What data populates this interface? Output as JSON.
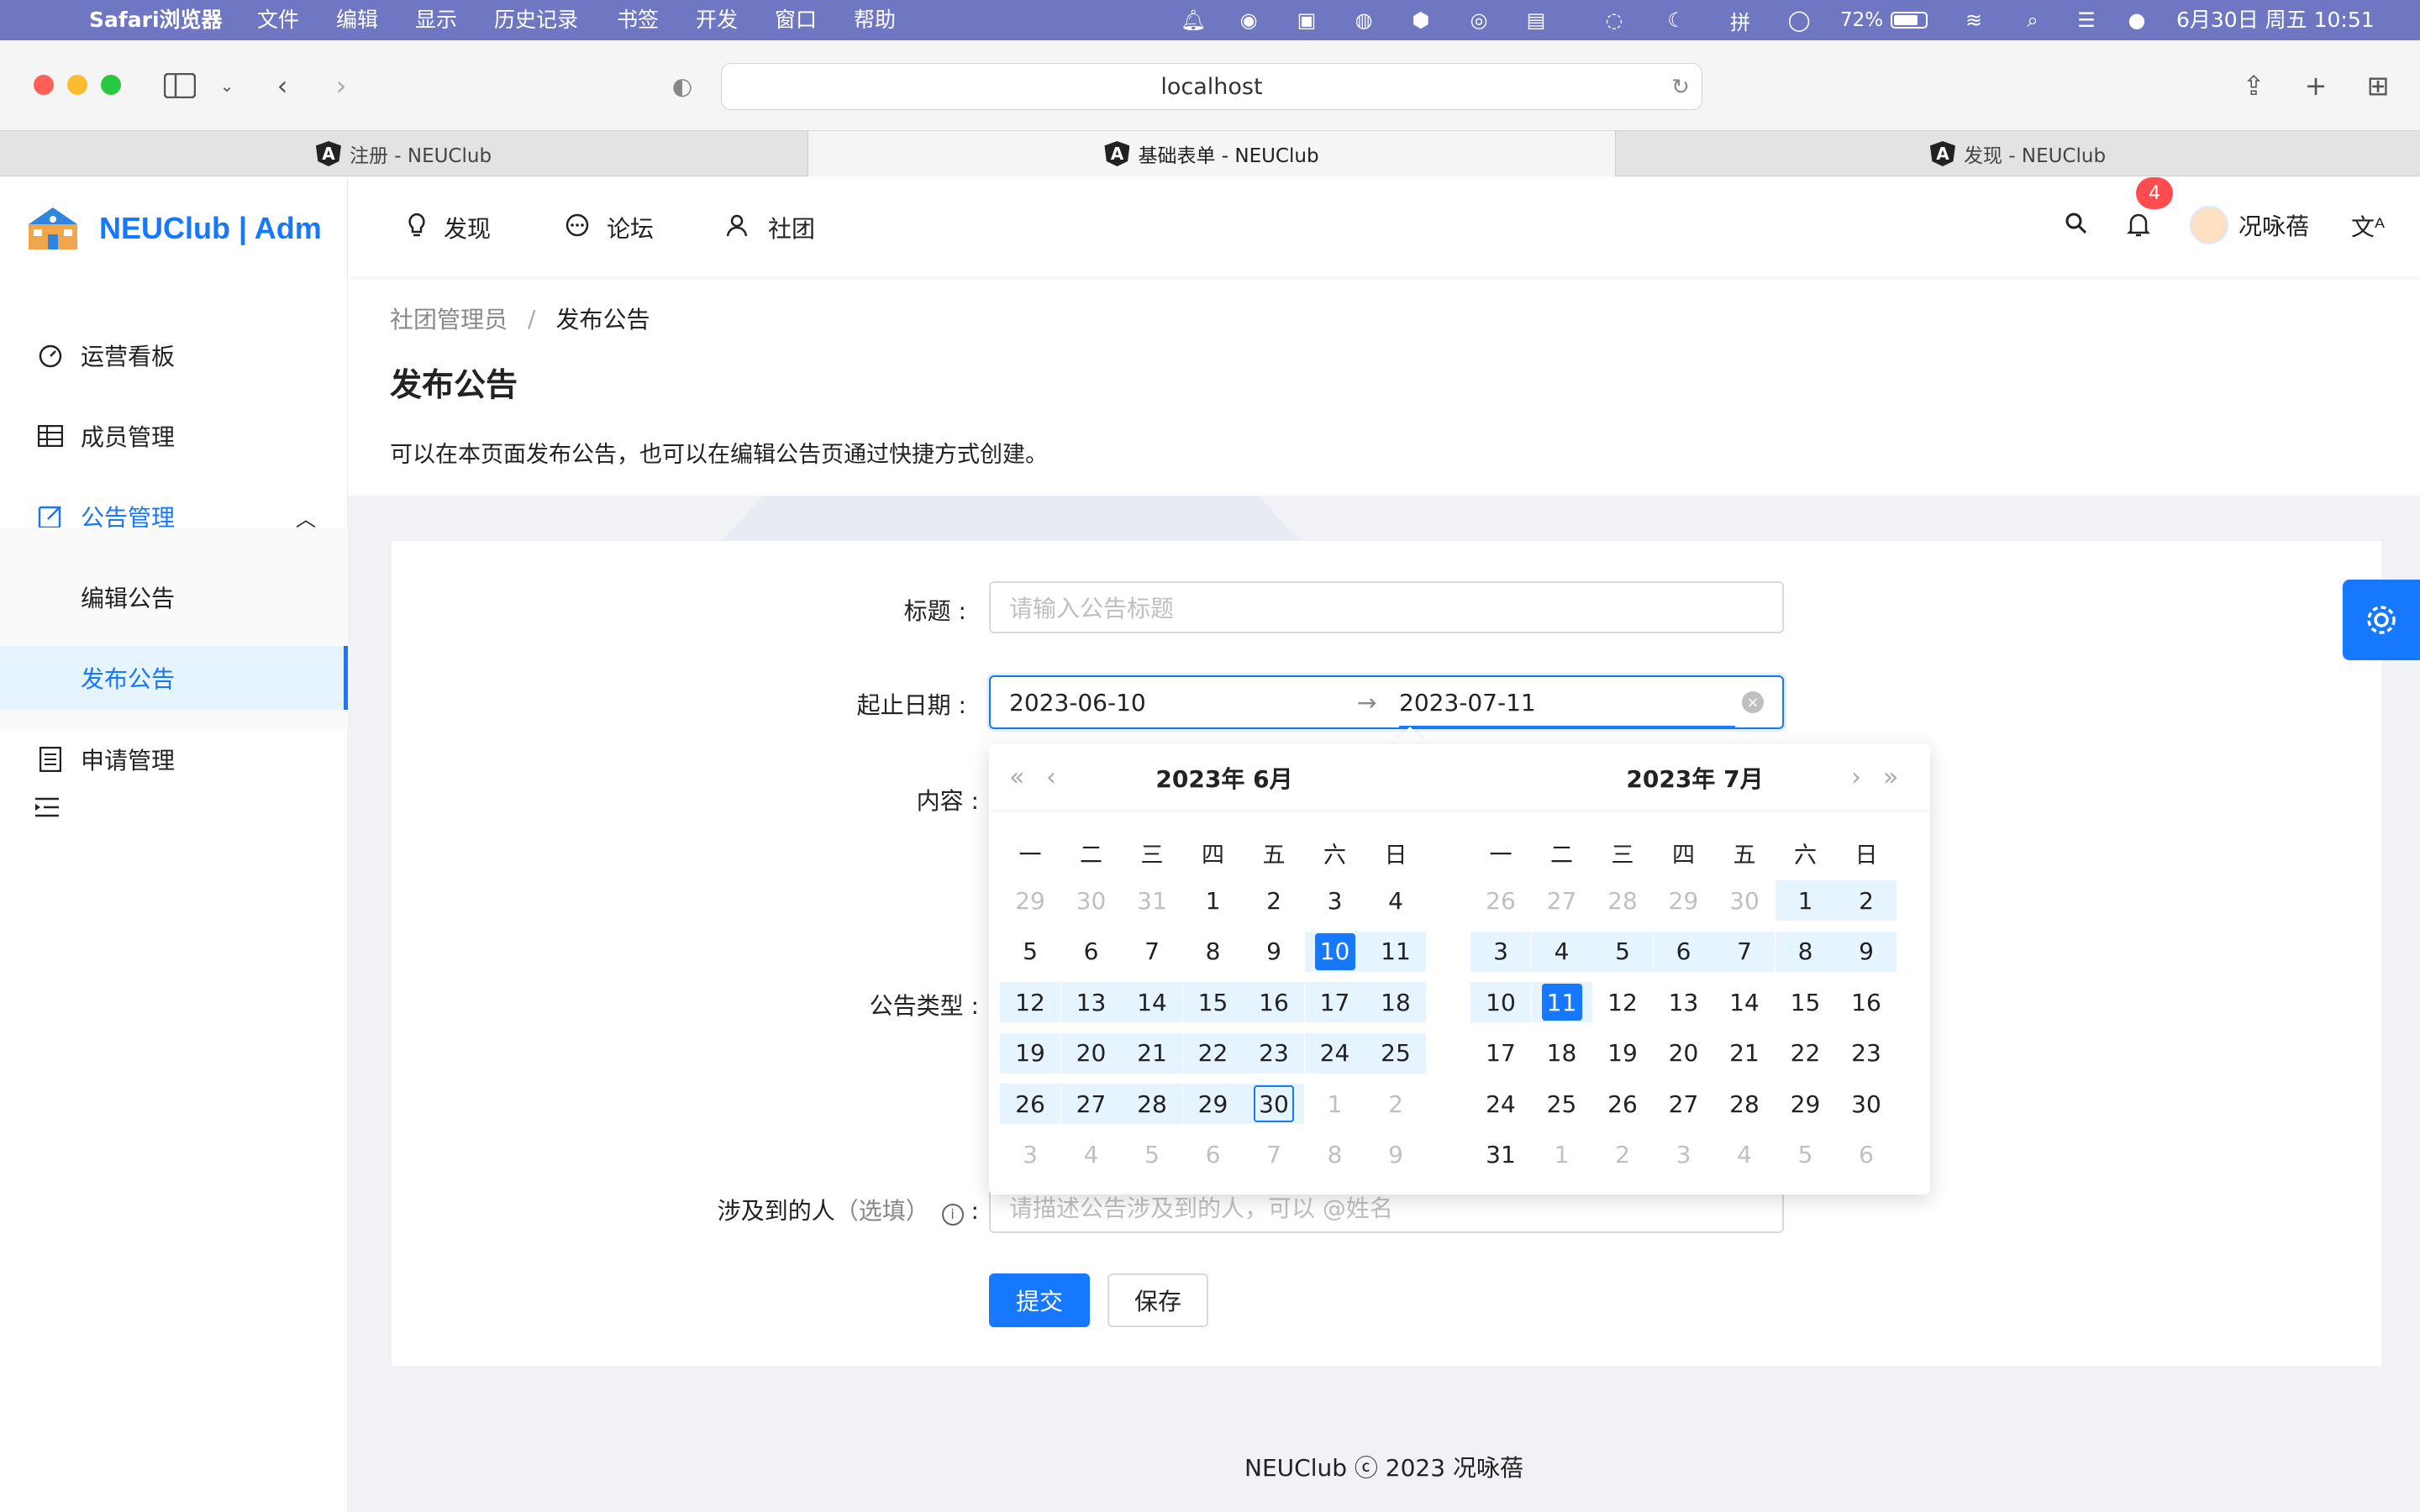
{
  "menubar": {
    "app": "Safari浏览器",
    "items": [
      "文件",
      "编辑",
      "显示",
      "历史记录",
      "书签",
      "开发",
      "窗口",
      "帮助"
    ],
    "battery": "72%",
    "datetime": "6月30日 周五  10:51"
  },
  "browser": {
    "url": "localhost",
    "tabs": [
      {
        "title": "注册 - NEUClub"
      },
      {
        "title": "基础表单 - NEUClub"
      },
      {
        "title": "发现 - NEUClub"
      }
    ]
  },
  "sidebar": {
    "logo": "NEUClub | Adm",
    "items": [
      {
        "label": "运营看板",
        "icon": "dashboard-icon"
      },
      {
        "label": "成员管理",
        "icon": "table-icon"
      },
      {
        "label": "公告管理",
        "icon": "edit-icon"
      },
      {
        "label": "编辑公告"
      },
      {
        "label": "发布公告"
      },
      {
        "label": "申请管理",
        "icon": "profile-icon"
      }
    ]
  },
  "header": {
    "nav": [
      {
        "label": "发现",
        "icon": "bulb-icon"
      },
      {
        "label": "论坛",
        "icon": "message-icon"
      },
      {
        "label": "社团",
        "icon": "team-icon"
      }
    ],
    "notification_count": "4",
    "user": "况咏蓓"
  },
  "page": {
    "breadcrumb": [
      "社团管理员",
      "发布公告"
    ],
    "title": "发布公告",
    "desc": "可以在本页面发布公告，也可以在编辑公告页通过快捷方式创建。"
  },
  "form": {
    "title_label": "标题",
    "title_placeholder": "请输入公告标题",
    "date_label": "起止日期",
    "start_date": "2023-06-10",
    "end_date": "2023-07-11",
    "content_label": "内容",
    "type_label": "公告类型",
    "people_label": "涉及到的人",
    "people_optional": "（选填）",
    "people_placeholder": "请描述公告涉及到的人，可以 @姓名",
    "submit": "提交",
    "save": "保存"
  },
  "calendar": {
    "left_title": "2023年  6月",
    "right_title": "2023年  7月",
    "weekdays": [
      "一",
      "二",
      "三",
      "四",
      "五",
      "六",
      "日"
    ]
  },
  "footer": "NEUClub ⓒ 2023 况咏蓓",
  "colors": {
    "accent": "#1677ff",
    "menubar": "#7077c2",
    "badge": "#ff4d4f"
  }
}
